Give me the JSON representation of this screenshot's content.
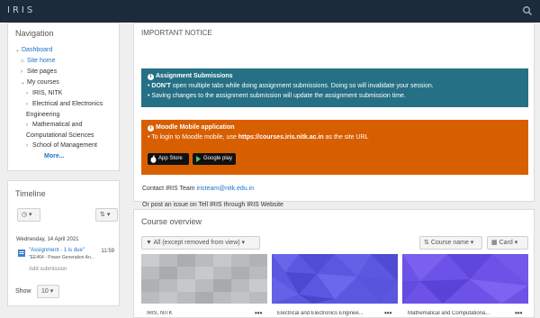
{
  "topbar": {
    "logo": "IRIS"
  },
  "nav": {
    "title": "Navigation",
    "dashboard": "Dashboard",
    "site_home": "Site home",
    "site_pages": "Site pages",
    "my_courses": "My courses",
    "courses": [
      "IRIS, NITK",
      "Electrical and Electronics",
      "Engineering",
      "Mathematical and",
      "Computational Sciences",
      "School of Management"
    ],
    "more": "More..."
  },
  "timeline": {
    "title": "Timeline",
    "date": "Wednesday, 14 April 2021",
    "item_title": "\"Assignment - 1 is due\"",
    "item_sub": "\"EE464 - Power Generation An...",
    "item_time": "11:59",
    "add": "Add submission",
    "show_label": "Show",
    "show_value": "10"
  },
  "notice": {
    "title": "IMPORTANT NOTICE",
    "box1_title": "Assignment Submissions",
    "box1_line1_bold": "DON'T",
    "box1_line1_rest": " open multiple tabs while doing assignment submissions. Doing so will invalidate your session.",
    "box1_line2": "Saving changes to the assignment submission will update the assignment submission time.",
    "box2_title": "Moodle Mobile application",
    "box2_line_pre": "To login to Moodle mobile, use ",
    "box2_line_bold": "https://courses.iris.nitk.ac.in",
    "box2_line_post": " as the site URL",
    "app_store": "App Store",
    "google_play": "Google play",
    "contact_pre": "Contact IRIS Team ",
    "contact_email": "iristeam@nitk.edu.in",
    "post": "Or post an issue on Tell IRIS through IRIS Website"
  },
  "overview": {
    "title": "Course overview",
    "filter": "All (except removed from view)",
    "sort": "Course name",
    "view": "Card",
    "courses": [
      "IRIS, NITK",
      "Electrical and Electronics Enginee...",
      "Mathematical and Computationa..."
    ],
    "more": "•••"
  }
}
